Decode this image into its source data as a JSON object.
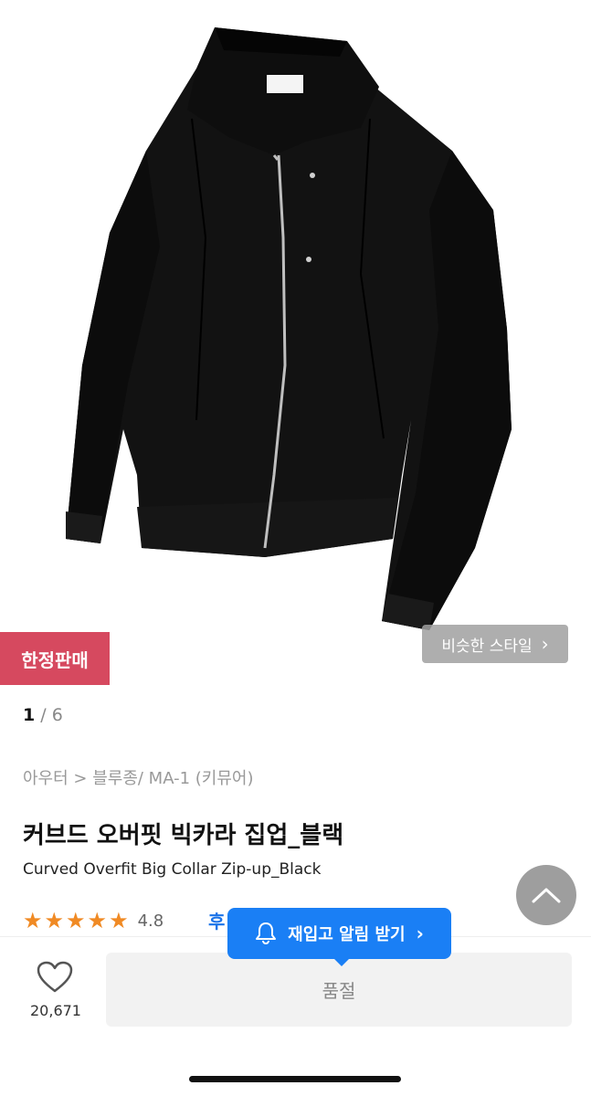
{
  "badges": {
    "limited": "한정판매"
  },
  "image_overlay": {
    "similar_style_label": "비슷한 스타일",
    "similar_style_chevron": "›"
  },
  "pagination": {
    "current": "1",
    "separator": " / ",
    "total": "6"
  },
  "breadcrumb": "아우터 > 블루종/ MA-1 (키뮤어)",
  "product": {
    "title_ko": "커브드 오버핏 빅카라 집업_블랙",
    "title_en": "Curved Overfit Big Collar Zip-up_Black",
    "rating": "4.8",
    "rating_stars": 5,
    "review_partial": "후"
  },
  "restock_tooltip": {
    "label": "재입고 알림 받기",
    "chevron": "›",
    "icon": "bell-icon"
  },
  "bottom_bar": {
    "like_count": "20,671",
    "soldout_label": "품절"
  },
  "colors": {
    "accent_blue": "#1a7ff5",
    "badge_red": "#d6495f",
    "star_orange": "#f08a24"
  }
}
